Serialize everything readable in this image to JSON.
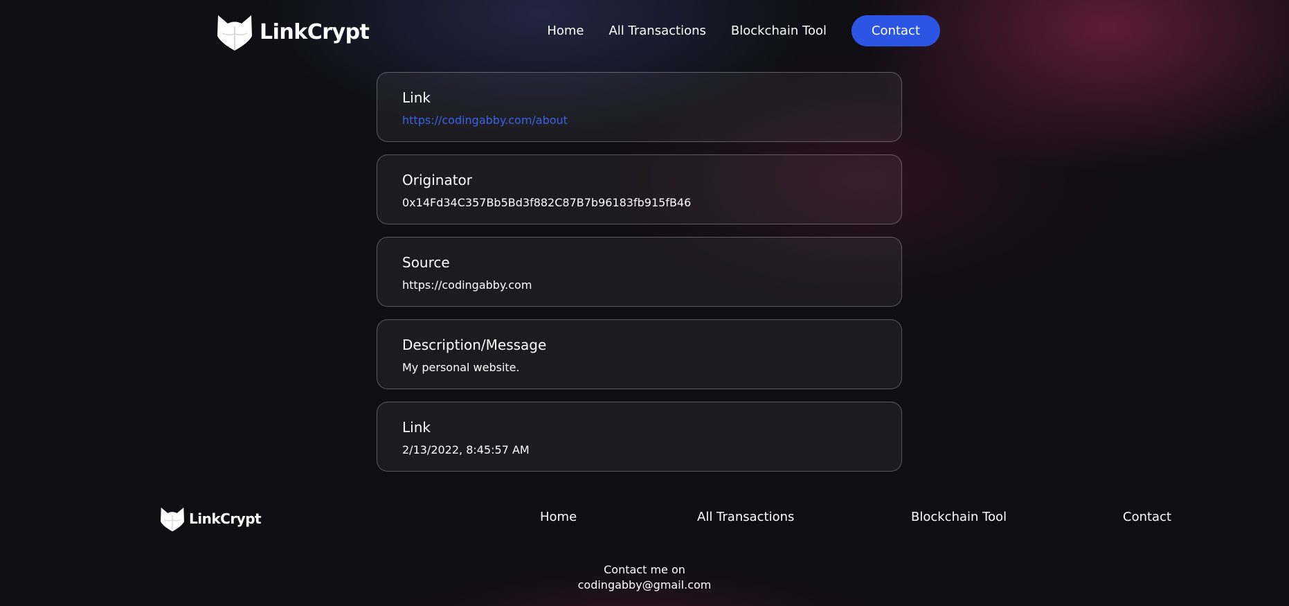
{
  "brand": {
    "name": "LinkCrypt",
    "logo_icon": "fox-head-icon"
  },
  "nav": {
    "home": "Home",
    "all_transactions": "All Transactions",
    "blockchain_tool": "Blockchain Tool",
    "contact": "Contact"
  },
  "cards": [
    {
      "label": "Link",
      "value": "https://codingabby.com/about",
      "is_link": true
    },
    {
      "label": "Originator",
      "value": "0x14Fd34C357Bb5Bd3f882C87B7b96183fb915fB46"
    },
    {
      "label": "Source",
      "value": "https://codingabby.com"
    },
    {
      "label": "Description/Message",
      "value": "My personal website."
    },
    {
      "label": "Link",
      "value": "2/13/2022, 8:45:57 AM"
    }
  ],
  "footer": {
    "nav": {
      "home": "Home",
      "all_transactions": "All Transactions",
      "blockchain_tool": "Blockchain Tool",
      "contact": "Contact"
    },
    "contact_line1": "Contact me on",
    "contact_email": "codingabby@gmail.com"
  },
  "colors": {
    "accent": "#2d55e3",
    "link": "#3b62e6",
    "background": "#0f0e13"
  }
}
